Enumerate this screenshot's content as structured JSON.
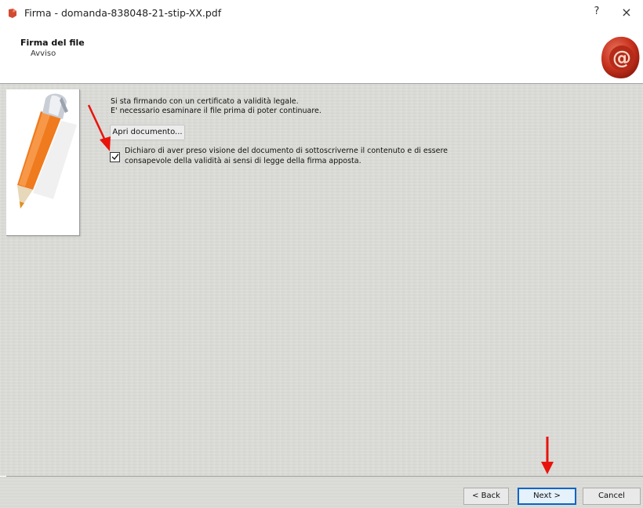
{
  "window": {
    "title": "Firma - domanda-838048-21-stip-XX.pdf",
    "help_label": "?",
    "close_label": "×"
  },
  "header": {
    "title": "Firma del file",
    "subtitle": "Avviso"
  },
  "content": {
    "message_line1": "Si sta firmando con un certificato a validità legale.",
    "message_line2": "E' necessario esaminare il file prima di poter continuare.",
    "open_document_label": "Apri documento...",
    "declaration": {
      "checked": true,
      "line1": "Dichiaro di aver preso visione del documento di sottoscriverne il contenuto e di essere",
      "line2": "consapevole della validità ai sensi di legge della firma apposta."
    }
  },
  "footer": {
    "back_label": "< Back",
    "next_label": "Next >",
    "cancel_label": "Cancel"
  },
  "colors": {
    "annotation_arrow": "#e8140c",
    "next_button_border": "#0a64c8",
    "panel_background": "#dcdcd8",
    "seal_red": "#c8321e"
  },
  "icons": [
    "app-icon",
    "wax-seal-icon",
    "pen-icon",
    "check-icon"
  ]
}
